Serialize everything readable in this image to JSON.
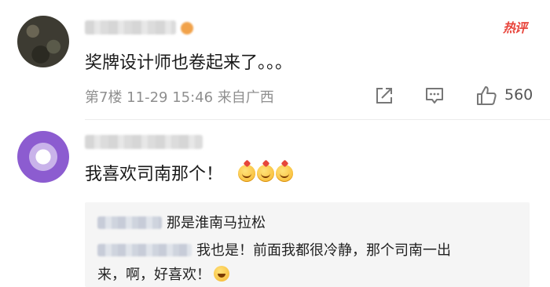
{
  "comments": [
    {
      "hot_label": "热评",
      "text": "奖牌设计师也卷起来了。。。",
      "meta": "第7楼 11-29 15:46 来自广西",
      "likes": "560"
    },
    {
      "text": "我喜欢司南那个！",
      "replies": [
        {
          "text": "那是淮南马拉松"
        },
        {
          "text_line1": "我也是！前面我都很冷静，那个司南一出",
          "text_line2": "来，啊，好喜欢！"
        }
      ]
    }
  ],
  "icons": {
    "share": "share-icon",
    "comment": "comment-icon",
    "like": "thumbs-up-icon"
  }
}
